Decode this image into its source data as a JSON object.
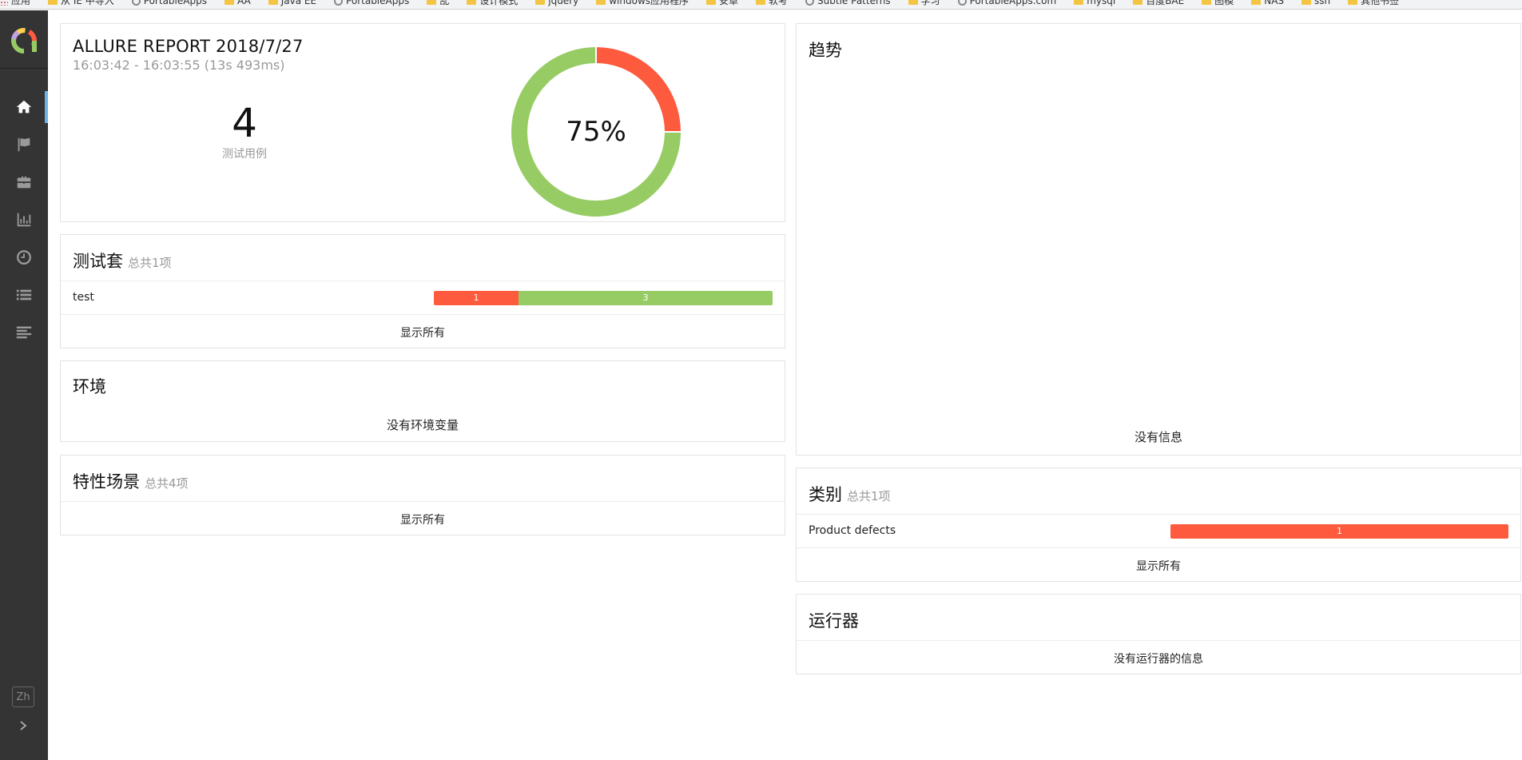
{
  "bookmarks": [
    {
      "icon": "apps",
      "label": "应用"
    },
    {
      "icon": "folder",
      "label": "从 IE 中导入"
    },
    {
      "icon": "globe",
      "label": "PortableApps"
    },
    {
      "icon": "folder",
      "label": "AA"
    },
    {
      "icon": "folder",
      "label": "Java EE"
    },
    {
      "icon": "globe",
      "label": "PortableApps"
    },
    {
      "icon": "folder",
      "label": "乱"
    },
    {
      "icon": "folder",
      "label": "设计模式"
    },
    {
      "icon": "folder",
      "label": "jquery"
    },
    {
      "icon": "folder",
      "label": "windows应用程序"
    },
    {
      "icon": "folder",
      "label": "安卓"
    },
    {
      "icon": "folder",
      "label": "软考"
    },
    {
      "icon": "globe",
      "label": "Subtle Patterns"
    },
    {
      "icon": "folder",
      "label": "学习"
    },
    {
      "icon": "globe",
      "label": "PortableApps.com"
    },
    {
      "icon": "folder",
      "label": "mysql"
    },
    {
      "icon": "folder",
      "label": "百度BAE"
    },
    {
      "icon": "folder",
      "label": "图模"
    },
    {
      "icon": "folder",
      "label": "NAS"
    },
    {
      "icon": "folder",
      "label": "ssh"
    },
    {
      "icon": "folder",
      "label": "其他书签"
    }
  ],
  "sidebar": {
    "items": [
      {
        "name": "overview",
        "icon": "home-icon",
        "active": true
      },
      {
        "name": "categories",
        "icon": "flag-icon",
        "active": false
      },
      {
        "name": "suites",
        "icon": "briefcase-icon",
        "active": false
      },
      {
        "name": "graphs",
        "icon": "bar-chart-icon",
        "active": false
      },
      {
        "name": "timeline",
        "icon": "clock-icon",
        "active": false
      },
      {
        "name": "behaviors",
        "icon": "list-icon",
        "active": false
      },
      {
        "name": "packages",
        "icon": "align-left-icon",
        "active": false
      }
    ],
    "language": "Zh",
    "collapse_icon": "chevron-right-icon"
  },
  "summary": {
    "title": "ALLURE REPORT 2018/7/27",
    "time": "16:03:42 - 16:03:55 (13s 493ms)",
    "count": "4",
    "count_label": "测试用例",
    "percent": "75%",
    "passed_fraction": 0.75,
    "colors": {
      "failed": "#fd5a3e",
      "passed": "#97cc64"
    }
  },
  "suites": {
    "title": "测试套",
    "count": "总共1项",
    "rows": [
      {
        "name": "test",
        "failed": 1,
        "passed": 3,
        "failed_label": "1",
        "passed_label": "3"
      }
    ],
    "show_all": "显示所有"
  },
  "environment": {
    "title": "环境",
    "empty": "没有环境变量"
  },
  "features": {
    "title": "特性场景",
    "count": "总共4项",
    "show_all": "显示所有"
  },
  "trend": {
    "title": "趋势",
    "empty": "没有信息"
  },
  "categories": {
    "title": "类别",
    "count": "总共1项",
    "rows": [
      {
        "name": "Product defects",
        "value_label": "1"
      }
    ],
    "show_all": "显示所有"
  },
  "executors": {
    "title": "运行器",
    "empty": "没有运行器的信息"
  }
}
